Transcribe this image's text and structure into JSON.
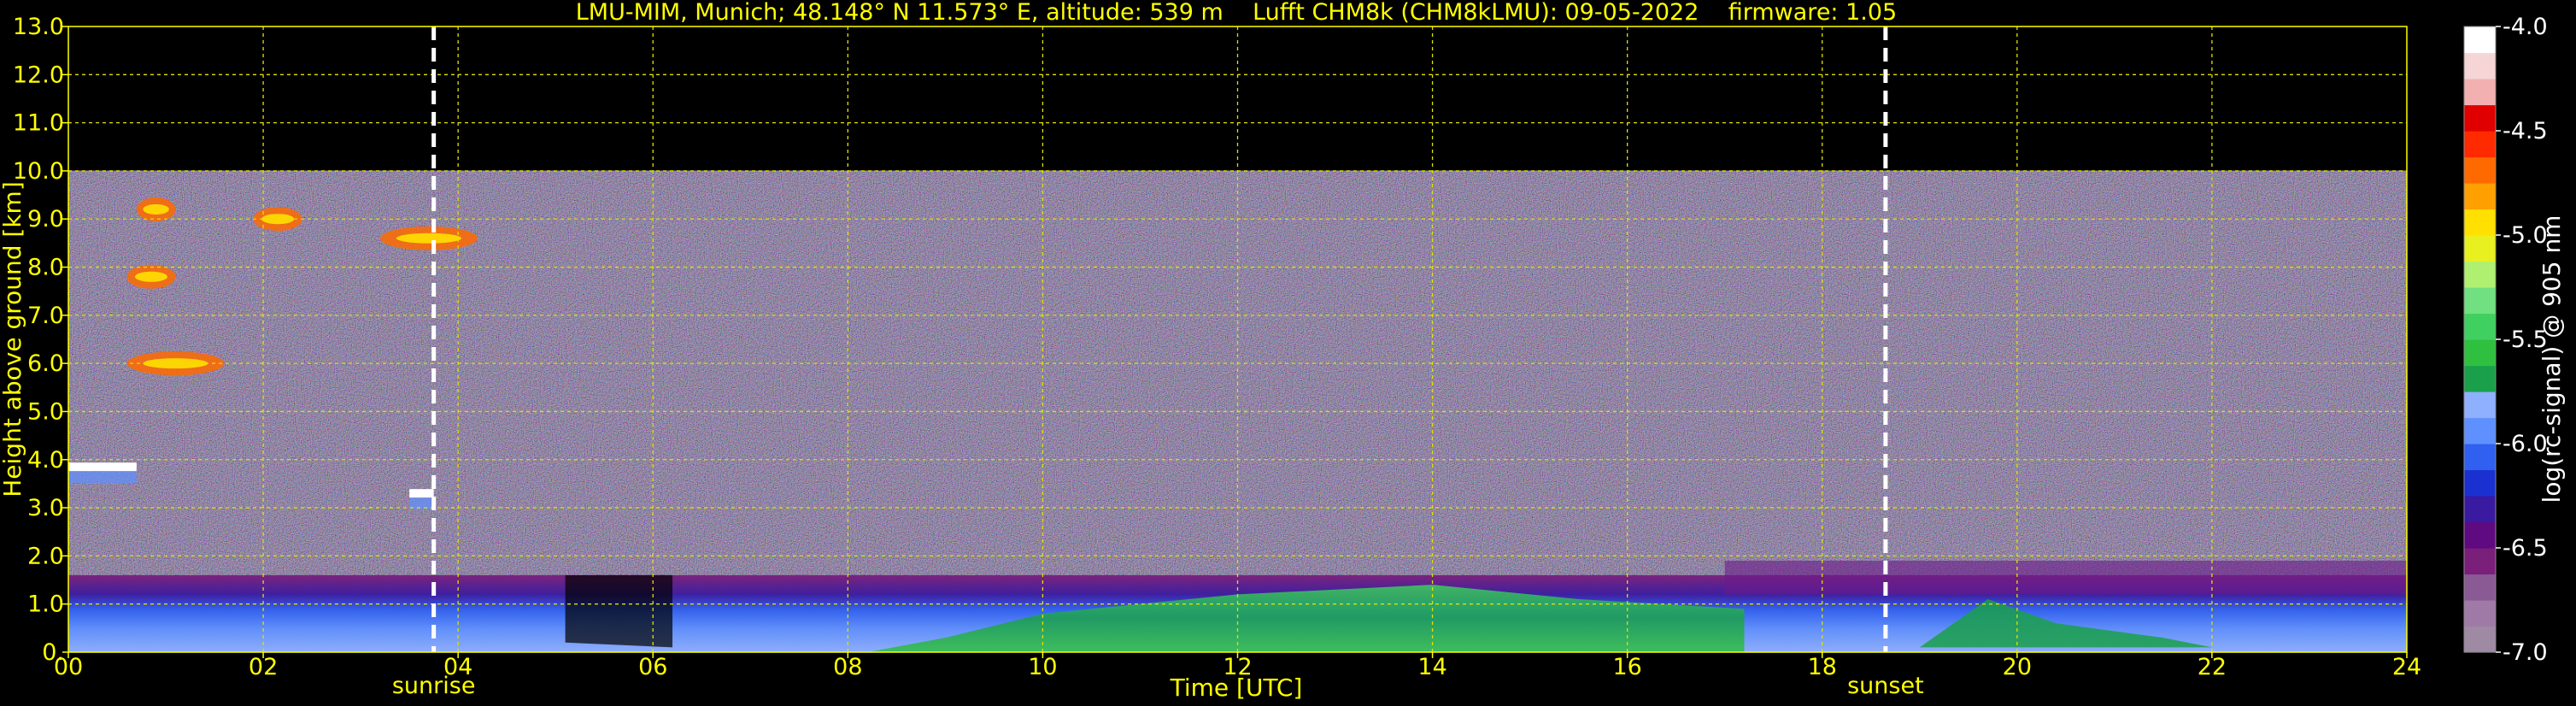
{
  "chart_data": {
    "type": "heatmap",
    "title": "LMU-MIM, Munich; 48.148° N 11.573° E, altitude: 539 m    Lufft CHM8k (CHM8kLMU): 09-05-2022    firmware: 1.05",
    "xlabel": "Time [UTC]",
    "ylabel": "Height above ground [km]",
    "x_ticks": [
      "00",
      "02",
      "04",
      "06",
      "08",
      "10",
      "12",
      "14",
      "16",
      "18",
      "20",
      "22",
      "24"
    ],
    "x_tick_values": [
      0,
      2,
      4,
      6,
      8,
      10,
      12,
      14,
      16,
      18,
      20,
      22,
      24
    ],
    "y_ticks": [
      "0.",
      "1.0",
      "2.0",
      "3.0",
      "4.0",
      "5.0",
      "6.0",
      "7.0",
      "8.0",
      "9.0",
      "10.0",
      "11.0",
      "12.0",
      "13.0"
    ],
    "y_tick_values": [
      0,
      1,
      2,
      3,
      4,
      5,
      6,
      7,
      8,
      9,
      10,
      11,
      12,
      13
    ],
    "xlim": [
      0,
      24
    ],
    "ylim": [
      0,
      13
    ],
    "grid": true,
    "data_top_km": 10,
    "markers": [
      {
        "label": "sunrise",
        "time_utc": 3.75
      },
      {
        "label": "sunset",
        "time_utc": 18.65
      }
    ],
    "colorbar": {
      "label": "log(rc-signal) @ 905 nm",
      "ticks": [
        "-4.0",
        "-4.5",
        "-5.0",
        "-5.5",
        "-6.0",
        "-6.5",
        "-7.0"
      ],
      "tick_values": [
        -4.0,
        -4.5,
        -5.0,
        -5.5,
        -6.0,
        -6.5,
        -7.0
      ],
      "range": [
        -7.0,
        -4.0
      ],
      "colors": [
        "#9e8aa3",
        "#a07aa6",
        "#8a5a95",
        "#7a1f7a",
        "#5f0a80",
        "#3a1aa0",
        "#1a30d0",
        "#2f60f0",
        "#5f90ff",
        "#8fb0ff",
        "#1aa04a",
        "#30c040",
        "#40d060",
        "#70e080",
        "#b0f070",
        "#e8f020",
        "#ffe000",
        "#ffa000",
        "#ff6a00",
        "#ff2a00",
        "#e00000",
        "#f2b0b0",
        "#f5d5d5",
        "#ffffff"
      ]
    },
    "features": [
      {
        "name": "boundary layer aerosol",
        "t_start": 0,
        "t_end": 24,
        "z_bottom": 0.0,
        "z_top": 1.6
      },
      {
        "name": "residual layer",
        "t_start": 17,
        "t_end": 24,
        "z_bottom": 1.2,
        "z_top": 1.9
      },
      {
        "name": "cirrus",
        "t_start": 0.7,
        "t_end": 1.1,
        "z_center": 9.2
      },
      {
        "name": "cirrus",
        "t_start": 1.9,
        "t_end": 2.4,
        "z_center": 9.0
      },
      {
        "name": "cirrus",
        "t_start": 0.6,
        "t_end": 1.1,
        "z_center": 7.8
      },
      {
        "name": "cirrus",
        "t_start": 0.6,
        "t_end": 1.6,
        "z_center": 6.0
      },
      {
        "name": "cirrus",
        "t_start": 3.2,
        "t_end": 4.2,
        "z_center": 8.6
      },
      {
        "name": "cloud base",
        "t_start": 0.0,
        "t_end": 0.7,
        "z_center": 3.85
      },
      {
        "name": "cloud base",
        "t_start": 3.5,
        "t_end": 3.75,
        "z_center": 3.3
      }
    ]
  }
}
